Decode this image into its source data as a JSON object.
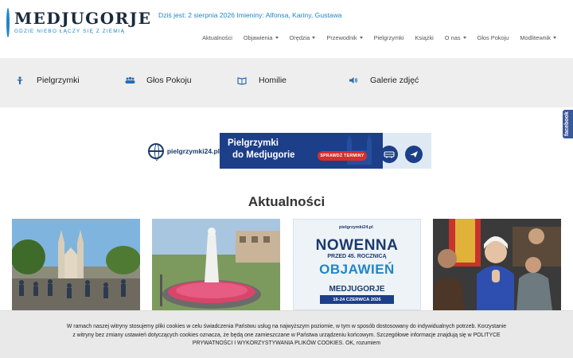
{
  "header": {
    "logo_title": "MEDJUGORJE",
    "logo_subtitle": "GDZIE NIEBO ŁĄCZY SIĘ Z ZIEMIĄ",
    "today_text": "Dziś jest: 2 sierpnia 2026 Imieniny: Alfonsa, Kariny, Gustawa"
  },
  "nav": {
    "items": [
      {
        "label": "Aktualności",
        "dropdown": false
      },
      {
        "label": "Objawienia",
        "dropdown": true
      },
      {
        "label": "Orędzia",
        "dropdown": true
      },
      {
        "label": "Przewodnik",
        "dropdown": true
      },
      {
        "label": "Pielgrzymki",
        "dropdown": false
      },
      {
        "label": "Książki",
        "dropdown": false
      },
      {
        "label": "O nas",
        "dropdown": true
      },
      {
        "label": "Głos Pokoju",
        "dropdown": false
      },
      {
        "label": "Modlitewnik",
        "dropdown": true
      }
    ]
  },
  "quick_links": [
    {
      "label": "Pielgrzymki",
      "icon": "pilgrim-icon"
    },
    {
      "label": "Głos Pokoju",
      "icon": "people-icon"
    },
    {
      "label": "Homilie",
      "icon": "book-icon"
    },
    {
      "label": "Galerie zdjęć",
      "icon": "speaker-icon"
    }
  ],
  "facebook_tab": "facebook",
  "banner": {
    "brand": "pielgrzymki24.pl",
    "line1": "Pielgrzymki",
    "line2": "do Medjugorie",
    "cta": "SPRAWDŹ TERMINY"
  },
  "news": {
    "title": "Aktualności",
    "card3": {
      "brand": "pielgrzymki24.pl",
      "line1": "NOWENNA",
      "line2": "PRZED 45. ROCZNICĄ",
      "line3": "OBJAWIEŃ",
      "line4": "MEDJUGORJE",
      "dates": "16-24 CZERWCA 2026"
    }
  },
  "cookie": {
    "line1": "W ramach naszej witryny stosujemy pliki cookies w celu świadczenia Państwu usług na najwyższym poziomie, w tym w sposób dostosowany do indywidualnych potrzeb. Korzystanie",
    "line2": "z witryny bez zmiany ustawień dotyczących cookies oznacza, że będą one zamieszczane w Państwa urządzeniu końcowym. Szczegółowe informacje znajdują się w",
    "policy_link": "POLITYCE PRYWATNOŚCI I WYKORZYSTYWANIA PLIKÓW COOKIES.",
    "accept": "OK, rozumiem"
  },
  "colors": {
    "brand_blue": "#1f86c8",
    "banner_navy": "#1d3f8a",
    "banner_red": "#d32f2f"
  }
}
